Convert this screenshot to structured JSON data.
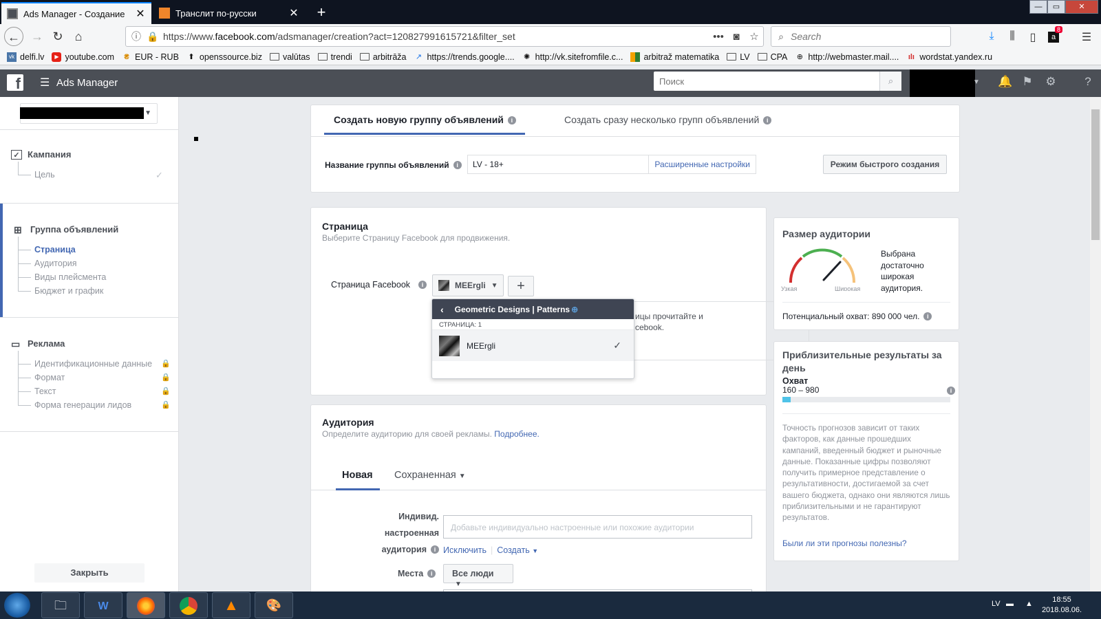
{
  "browser": {
    "tabs": [
      {
        "title": "Ads Manager - Создание",
        "active": true
      },
      {
        "title": "Транслит по-русски",
        "active": false
      }
    ],
    "url_prefix": "https://www.",
    "url_domain": "facebook.com",
    "url_rest": "/adsmanager/creation?act=120827991615721&filter_set",
    "search_placeholder": "Search",
    "badge_count": "8",
    "bookmarks": [
      {
        "label": "delfi.lv",
        "icon": "vk-icon"
      },
      {
        "label": "youtube.com",
        "icon": "youtube-icon"
      },
      {
        "label": "EUR - RUB",
        "icon": "currency-icon"
      },
      {
        "label": "openssource.biz",
        "icon": "site-icon"
      },
      {
        "label": "valūtas",
        "icon": "folder-icon"
      },
      {
        "label": "trendi",
        "icon": "folder-icon"
      },
      {
        "label": "arbitrāža",
        "icon": "folder-icon"
      },
      {
        "label": "https://trends.google....",
        "icon": "trends-icon"
      },
      {
        "label": "http://vk.sitefromfile.c...",
        "icon": "gear-icon"
      },
      {
        "label": "arbitraž matematika",
        "icon": "grid-icon"
      },
      {
        "label": "LV",
        "icon": "folder-icon"
      },
      {
        "label": "CPA",
        "icon": "folder-icon"
      },
      {
        "label": "http://webmaster.mail....",
        "icon": "globe-icon"
      },
      {
        "label": "wordstat.yandex.ru",
        "icon": "chart-icon"
      }
    ]
  },
  "header": {
    "app_title": "Ads Manager",
    "search_placeholder": "Поиск"
  },
  "sidebar": {
    "campaign": {
      "label": "Кампания",
      "items": [
        {
          "label": "Цель"
        }
      ]
    },
    "adset": {
      "label": "Группа объявлений",
      "items": [
        {
          "label": "Страница"
        },
        {
          "label": "Аудитория"
        },
        {
          "label": "Виды плейсмента"
        },
        {
          "label": "Бюджет и график"
        }
      ]
    },
    "ad": {
      "label": "Реклама",
      "items": [
        {
          "label": "Идентификационные данные"
        },
        {
          "label": "Формат"
        },
        {
          "label": "Текст"
        },
        {
          "label": "Форма генерации лидов"
        }
      ]
    },
    "close_label": "Закрыть"
  },
  "main": {
    "tab_new": "Создать новую группу объявлений",
    "tab_multi": "Создать сразу несколько групп объявлений",
    "name_label": "Название группы объявлений",
    "name_value": "LV - 18+",
    "advanced_link": "Расширенные настройки",
    "quick_mode": "Режим быстрого создания",
    "page_section": {
      "title": "Страница",
      "subtitle": "Выберите Страницу Facebook для продвижения.",
      "fb_page_label": "Страница Facebook",
      "selected_page": "MEErglі",
      "hint_line1": "ицы прочитайте и",
      "hint_line2": "cebook."
    },
    "popup": {
      "title": "Geometric Designs | Patterns",
      "count": "СТРАНИЦА: 1",
      "item": "MEErglі"
    },
    "audience": {
      "title": "Аудитория",
      "subtitle": "Определите аудиторию для своей рекламы.",
      "more_link": "Подробнее.",
      "tab_new": "Новая",
      "tab_saved": "Сохраненная",
      "custom_label_1": "Индивид. настроенная",
      "custom_label_2": "аудитория",
      "custom_placeholder": "Добавьте индивидуально настроенные или похожие аудитории",
      "exclude_link": "Исключить",
      "create_link": "Создать",
      "places_label": "Места",
      "places_value": "Все люди"
    }
  },
  "right": {
    "audience_size": {
      "title": "Размер аудитории",
      "narrow": "Узкая",
      "wide": "Широкая",
      "desc_1": "Выбрана",
      "desc_2": "достаточно",
      "desc_3": "широкая",
      "desc_4": "аудитория.",
      "potential_reach": "Потенциальный охват: 890 000 чел."
    },
    "daily": {
      "title_1": "Приблизительные результаты за",
      "title_2": "день",
      "metric": "Охват",
      "range": "160 – 980",
      "progress_fraction": 0.05,
      "disclaimer": "Точность прогнозов зависит от таких факторов, как данные прошедших кампаний, введенный бюджет и рыночные данные. Показанные цифры позволяют получить примерное представление о результативности, достигаемой за счет вашего бюджета, однако они являются лишь приблизительными и не гарантируют результатов.",
      "feedback": "Были ли эти прогнозы полезны?"
    }
  },
  "taskbar": {
    "lang": "LV",
    "time": "18:55",
    "date": "2018.08.06."
  },
  "colors": {
    "fb_blue": "#4267b2",
    "header": "#4b4f56",
    "progress": "#4fc3e8"
  }
}
